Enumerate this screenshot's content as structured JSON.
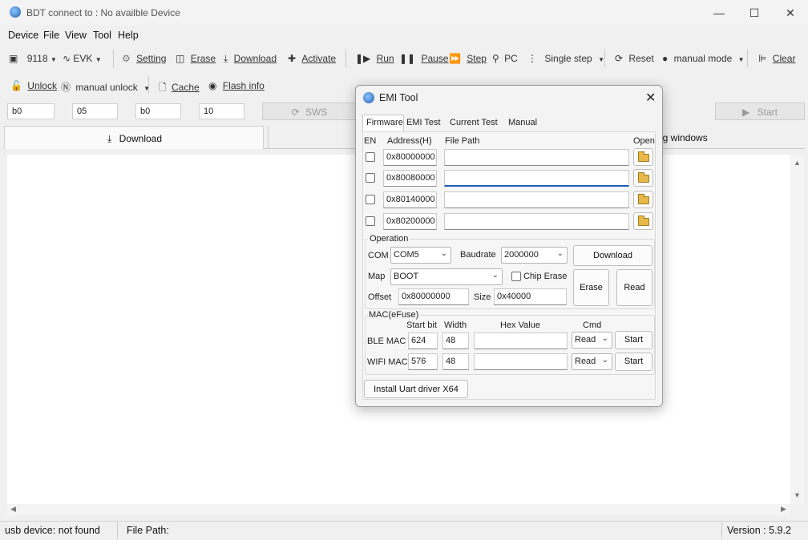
{
  "window": {
    "title": "BDT connect to : No availble Device"
  },
  "menubar": [
    "Device",
    "File",
    "View",
    "Tool",
    "Help"
  ],
  "toolbar1": {
    "chip": "9118",
    "board": "EVK",
    "setting": "Setting",
    "erase": "Erase",
    "download": "Download",
    "activate": "Activate",
    "run": "Run",
    "pause": "Pause",
    "step": "Step",
    "pc": "PC",
    "single_step": "Single step",
    "reset": "Reset",
    "mode": "manual mode",
    "clear": "Clear"
  },
  "toolbar2": {
    "unlock": "Unlock",
    "manual_unlock": "manual unlock",
    "cache": "Cache",
    "flash_info": "Flash info"
  },
  "params": {
    "v1": "b0",
    "v2": "05",
    "v3": "b0",
    "v4": "10",
    "sws": "SWS",
    "start": "Start"
  },
  "main": {
    "download_tab": "Download",
    "log_tab": "og windows"
  },
  "status": {
    "usb": "usb device: not found",
    "file_path": "File Path:",
    "version": "Version : 5.9.2"
  },
  "dialog": {
    "title": "EMI Tool",
    "tabs": [
      "Firmware",
      "EMI Test",
      "Current Test",
      "Manual"
    ],
    "headers": {
      "en": "EN",
      "address": "Address(H)",
      "file_path": "File Path",
      "open": "Open"
    },
    "rows": [
      {
        "address": "0x80000000",
        "path": ""
      },
      {
        "address": "0x80080000",
        "path": ""
      },
      {
        "address": "0x80140000",
        "path": ""
      },
      {
        "address": "0x80200000",
        "path": ""
      }
    ],
    "operation": {
      "label": "Operation",
      "com_label": "COM",
      "com": "COM5",
      "baud_label": "Baudrate",
      "baud": "2000000",
      "download": "Download",
      "map_label": "Map",
      "map": "BOOT",
      "chip_erase": "Chip Erase",
      "erase": "Erase",
      "read": "Read",
      "offset_label": "Offset",
      "offset": "0x80000000",
      "size_label": "Size",
      "size": "0x40000"
    },
    "mac": {
      "label": "MAC(eFuse)",
      "col_start": "Start bit",
      "col_width": "Width",
      "col_hex": "Hex Value",
      "col_cmd": "Cmd",
      "ble_label": "BLE  MAC",
      "ble_start": "624",
      "ble_width": "48",
      "ble_hex": "",
      "ble_cmd": "Read",
      "ble_btn": "Start",
      "wifi_label": "WIFI MAC",
      "wifi_start": "576",
      "wifi_width": "48",
      "wifi_hex": "",
      "wifi_cmd": "Read",
      "wifi_btn": "Start"
    },
    "install": "Install Uart driver X64"
  }
}
